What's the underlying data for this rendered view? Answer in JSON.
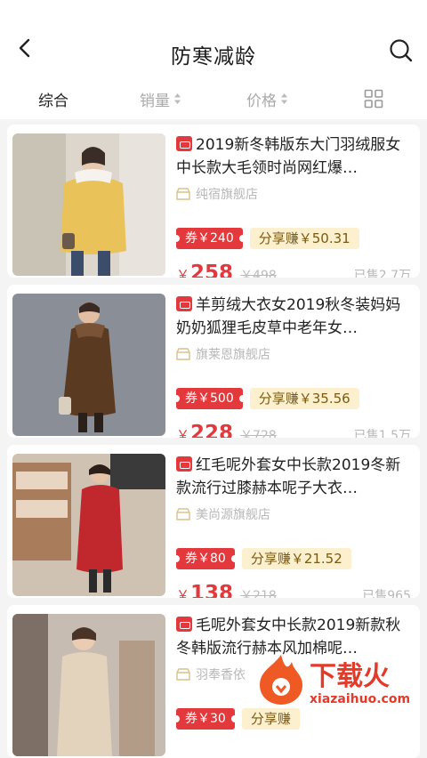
{
  "header": {
    "title": "防寒减龄",
    "back_icon": "chevron-left-icon",
    "search_icon": "search-icon"
  },
  "sort_tabs": [
    {
      "label": "综合",
      "active": true
    },
    {
      "label": "销量",
      "active": false
    },
    {
      "label": "价格",
      "active": false
    }
  ],
  "layout_toggle_icon": "grid-icon",
  "products": [
    {
      "title": "2019新冬韩版东大门羽绒服女中长款大毛领时尚网红爆…",
      "shop": "纯宿旗舰店",
      "coupon": "券￥240",
      "share": "分享赚￥50.31",
      "currency": "￥",
      "price": "258",
      "original_price": "￥498",
      "sold": "已售2.7万",
      "thumb_colors": [
        "#e9c25a",
        "#dcd6cc"
      ]
    },
    {
      "title": "羊剪绒大衣女2019秋冬装妈妈奶奶狐狸毛皮草中老年女…",
      "shop": "旗莱恩旗舰店",
      "coupon": "券￥500",
      "share": "分享赚￥35.56",
      "currency": "￥",
      "price": "228",
      "original_price": "￥728",
      "sold": "已售1.5万",
      "thumb_colors": [
        "#5b3a22",
        "#8a8f97"
      ]
    },
    {
      "title": "红毛呢外套女中长款2019冬新款流行过膝赫本呢子大衣…",
      "shop": "美尚源旗舰店",
      "coupon": "券￥80",
      "share": "分享赚￥21.52",
      "currency": "￥",
      "price": "138",
      "original_price": "￥218",
      "sold": "已售965",
      "thumb_colors": [
        "#c0282e",
        "#cfc2b2"
      ]
    },
    {
      "title": "毛呢外套女中长款2019新款秋冬韩版流行赫本风加棉呢…",
      "shop": "羽奉香依",
      "coupon": "券￥30",
      "share": "分享赚",
      "currency": "",
      "price": "",
      "original_price": "",
      "sold": "",
      "thumb_colors": [
        "#e3d3bd",
        "#c7bcb2"
      ]
    }
  ],
  "watermark": {
    "text": "下载火",
    "domain": "xiazaihuo.com"
  },
  "colors": {
    "accent": "#e4393c",
    "share_bg": "#fdf0cf",
    "muted": "#b8b8b8"
  }
}
